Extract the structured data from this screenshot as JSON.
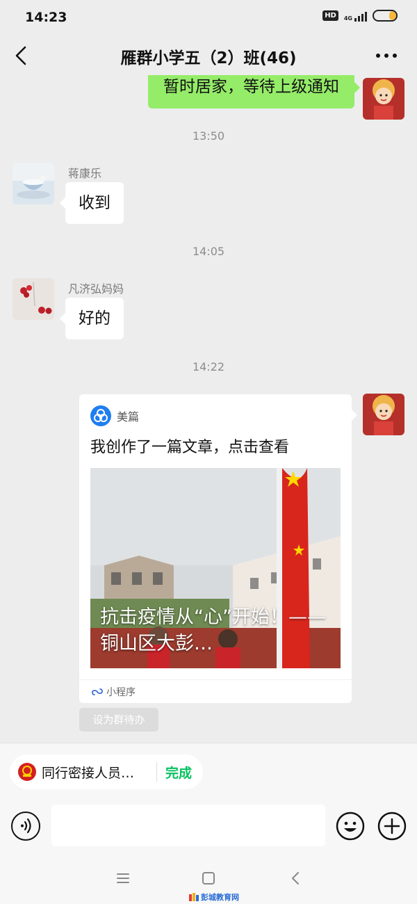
{
  "status_bar": {
    "time": "14:23",
    "hd_label": "HD",
    "network_label": "4G",
    "battery_level": 0.3
  },
  "header": {
    "title": "雁群小学五（2）班(46)",
    "back_icon": "chevron-left-icon",
    "more_icon": "more-dots-icon"
  },
  "messages": [
    {
      "type": "own_text",
      "text": "暂时居家，等待上级通知"
    },
    {
      "type": "timestamp",
      "text": "13:50"
    },
    {
      "type": "text",
      "sender": "蒋康乐",
      "text": "收到"
    },
    {
      "type": "timestamp",
      "text": "14:05"
    },
    {
      "type": "text",
      "sender": "凡济弘妈妈",
      "text": "好的"
    },
    {
      "type": "timestamp",
      "text": "14:22"
    },
    {
      "type": "own_card",
      "source": "美篇",
      "title": "我创作了一篇文章，点击查看",
      "image_caption": "抗击疫情从“心”开始！——铜山区大彭…",
      "footer": "小程序"
    }
  ],
  "group_todo_button": "设为群待办",
  "task_bar": {
    "text": "同行密接人员…",
    "action": "完成"
  },
  "input": {
    "value": "",
    "placeholder": ""
  },
  "watermark": "彭城教育网",
  "colors": {
    "own_bubble": "#95ec69",
    "accent_green": "#07c160",
    "background": "#ededed"
  }
}
